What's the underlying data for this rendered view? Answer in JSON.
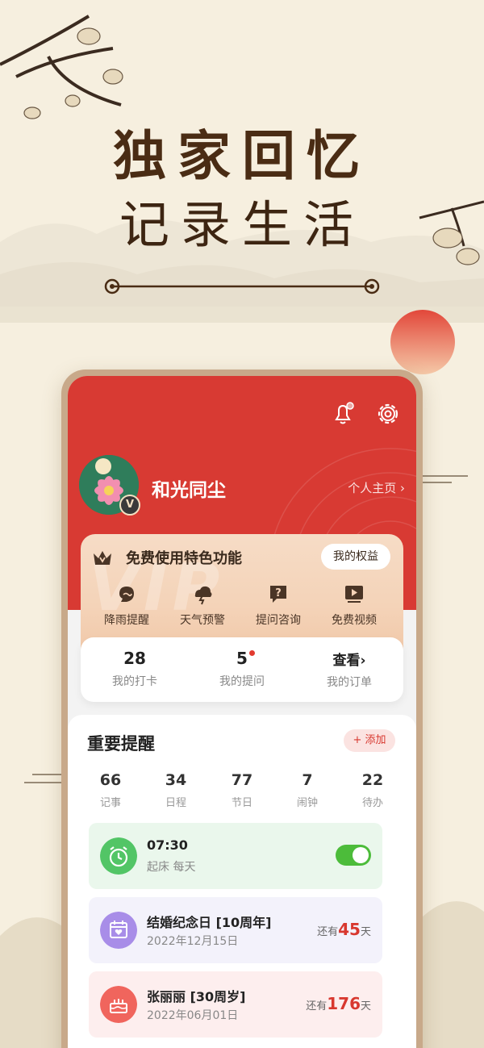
{
  "hero": {
    "line1": "独家回忆",
    "line2": "记录生活"
  },
  "profile": {
    "name": "和光同尘",
    "badge": "V",
    "home_link": "个人主页 ›"
  },
  "vip": {
    "watermark": "VIP",
    "title": "免费使用特色功能",
    "rights_button": "我的权益",
    "features": [
      {
        "label": "降雨提醒",
        "icon": "rain-icon"
      },
      {
        "label": "天气预警",
        "icon": "weather-warning-icon"
      },
      {
        "label": "提问咨询",
        "icon": "question-icon"
      },
      {
        "label": "免费视频",
        "icon": "video-icon"
      }
    ]
  },
  "stats": [
    {
      "value": "28",
      "label": "我的打卡"
    },
    {
      "value": "5",
      "label": "我的提问"
    },
    {
      "value": "查看›",
      "label": "我的订单"
    }
  ],
  "reminders": {
    "title": "重要提醒",
    "add_button": "+ 添加",
    "counts": [
      {
        "value": "66",
        "label": "记事"
      },
      {
        "value": "34",
        "label": "日程"
      },
      {
        "value": "77",
        "label": "节日"
      },
      {
        "value": "7",
        "label": "闹钟"
      },
      {
        "value": "22",
        "label": "待办"
      }
    ],
    "items": [
      {
        "title": "07:30",
        "subtitle": "起床 每天",
        "toggle_on": true
      },
      {
        "title": "结婚纪念日 [10周年]",
        "subtitle": "2022年12月15日",
        "prefix": "还有",
        "days": "45",
        "suffix": "天"
      },
      {
        "title": "张丽丽 [30周岁]",
        "subtitle": "2022年06月01日",
        "prefix": "还有",
        "days": "176",
        "suffix": "天"
      }
    ]
  },
  "colors": {
    "header_red": "#d83a33",
    "alarm_green": "#4cbc3a",
    "anniversary_purple": "#a88de8",
    "birthday_red": "#f0655d"
  }
}
